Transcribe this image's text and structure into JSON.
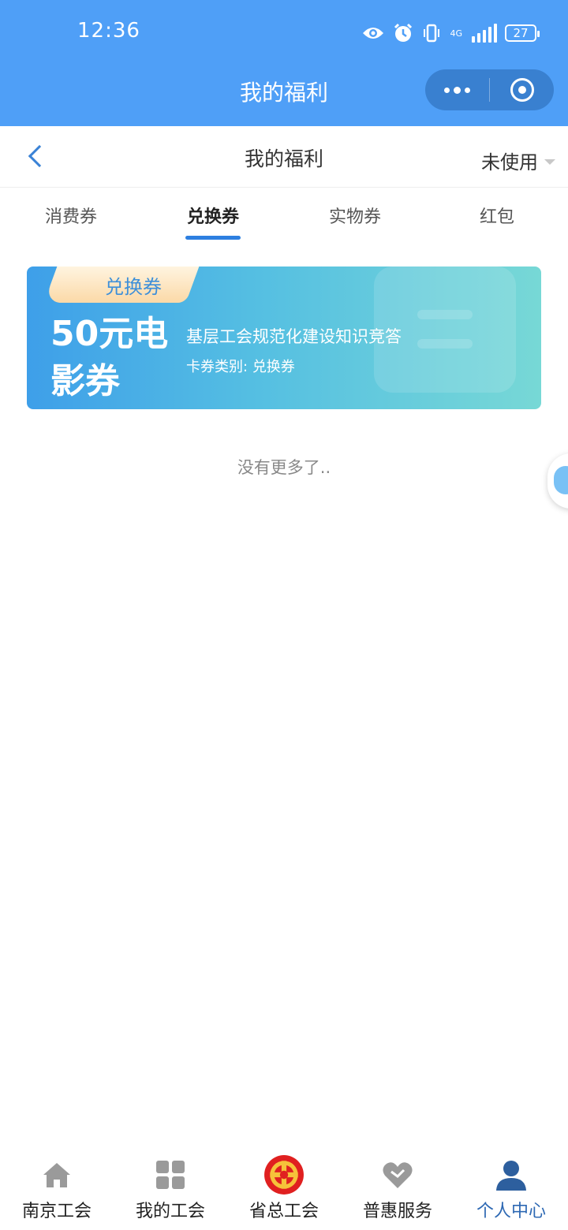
{
  "status_bar": {
    "time": "12:36",
    "network": "4G",
    "battery": "27",
    "icons": [
      "eye-icon",
      "alarm-icon",
      "vibrate-icon",
      "signal-icon",
      "battery-icon"
    ]
  },
  "mini_program": {
    "title": "我的福利",
    "capsule_icons": [
      "more-icon",
      "close-target-icon"
    ]
  },
  "nav": {
    "title": "我的福利",
    "filter": "未使用"
  },
  "tabs": [
    {
      "label": "消费券",
      "active": false
    },
    {
      "label": "兑换券",
      "active": true
    },
    {
      "label": "实物券",
      "active": false
    },
    {
      "label": "红包",
      "active": false
    }
  ],
  "coupon": {
    "tag": "兑换券",
    "amount": "50元电影券",
    "title": "基层工会规范化建设知识竞答",
    "type_label": "卡券类别:",
    "type_value": "兑换券"
  },
  "list_end_text": "没有更多了..",
  "bottom_tabs": [
    {
      "label": "南京工会",
      "icon": "home-icon",
      "active": false
    },
    {
      "label": "我的工会",
      "icon": "grid-icon",
      "active": false
    },
    {
      "label": "省总工会",
      "icon": "union-emblem-icon",
      "active": false
    },
    {
      "label": "普惠服务",
      "icon": "heart-icon",
      "active": false
    },
    {
      "label": "个人中心",
      "icon": "person-icon",
      "active": true
    }
  ],
  "colors": {
    "header_blue": "#4f9ff7",
    "accent": "#2d7fe0",
    "active_tab_label": "#2d68b3",
    "emblem_red": "#e02020"
  }
}
